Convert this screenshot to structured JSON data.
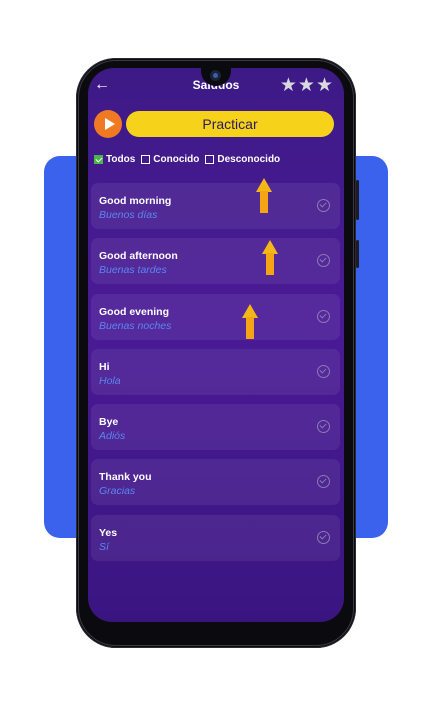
{
  "screen": {
    "title": "Saludos",
    "back_icon": "←",
    "stars": "★★★",
    "practice_label": "Practicar"
  },
  "filters": [
    {
      "label": "Todos",
      "checked": true
    },
    {
      "label": "Conocido",
      "checked": false
    },
    {
      "label": "Desconocido",
      "checked": false
    }
  ],
  "phrases": [
    {
      "phrase": "Good morning",
      "translation": "Buenos días"
    },
    {
      "phrase": "Good afternoon",
      "translation": "Buenas tardes"
    },
    {
      "phrase": "Good evening",
      "translation": "Buenas noches"
    },
    {
      "phrase": "Hi",
      "translation": "Hola"
    },
    {
      "phrase": "Bye",
      "translation": "Adiós"
    },
    {
      "phrase": "Thank you",
      "translation": "Gracias"
    },
    {
      "phrase": "Yes",
      "translation": "Sí"
    }
  ],
  "colors": {
    "accent_yellow": "#f7d21a",
    "play_orange": "#f07a24",
    "background_purple": "#3d1a86",
    "translation_blue": "#5b86f0",
    "backdrop_blue": "#3a62ec"
  }
}
